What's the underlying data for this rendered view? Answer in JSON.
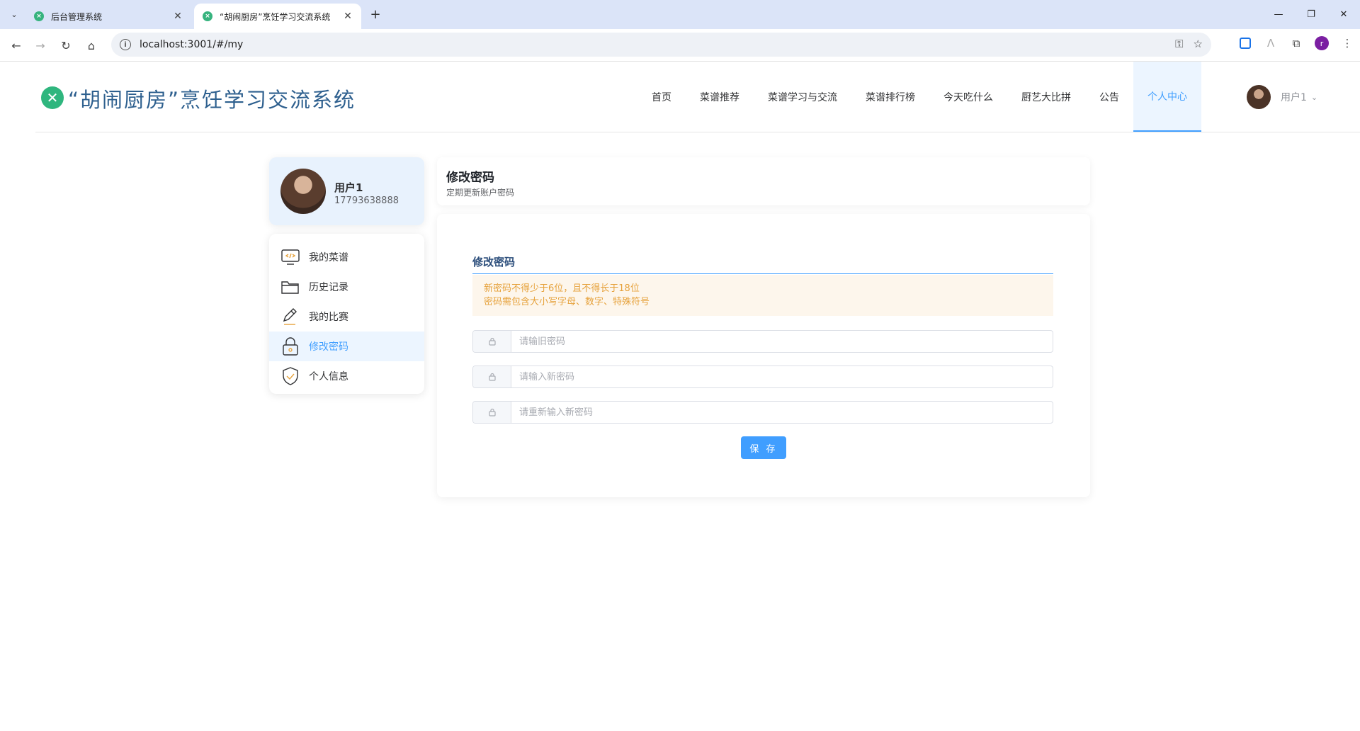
{
  "browser": {
    "tabs": [
      {
        "title": "后台管理系统",
        "close": "✕"
      },
      {
        "title": "“胡闹厨房”烹饪学习交流系统",
        "close": "✕"
      }
    ],
    "new_tab": "+",
    "url": "localhost:3001/#/my",
    "profile_initial": "r"
  },
  "header": {
    "logo_text": "“胡闹厨房”烹饪学习交流系统",
    "nav": [
      "首页",
      "菜谱推荐",
      "菜谱学习与交流",
      "菜谱排行榜",
      "今天吃什么",
      "厨艺大比拼",
      "公告",
      "个人中心"
    ],
    "active_nav": "个人中心",
    "username": "用户1"
  },
  "sidebar": {
    "user_name": "用户1",
    "user_phone": "17793638888",
    "menu": [
      {
        "label": "我的菜谱",
        "icon": "recipe-code-icon"
      },
      {
        "label": "历史记录",
        "icon": "folder-icon"
      },
      {
        "label": "我的比赛",
        "icon": "pencil-icon"
      },
      {
        "label": "修改密码",
        "icon": "lock-icon"
      },
      {
        "label": "个人信息",
        "icon": "shield-check-icon"
      }
    ],
    "active_menu": "修改密码"
  },
  "content": {
    "title": "修改密码",
    "subtitle": "定期更新账户密码",
    "form_title": "修改密码",
    "alert_line1": "新密码不得少于6位，且不得长于18位",
    "alert_line2": "密码需包含大小写字母、数字、特殊符号",
    "old_password_placeholder": "请输旧密码",
    "new_password_placeholder": "请输入新密码",
    "confirm_password_placeholder": "请重新输入新密码",
    "save_label": "保 存"
  },
  "colors": {
    "primary": "#409eff",
    "logo_green": "#2fb67e",
    "warning_text": "#e6a23c",
    "warning_bg": "#fdf6ec"
  }
}
